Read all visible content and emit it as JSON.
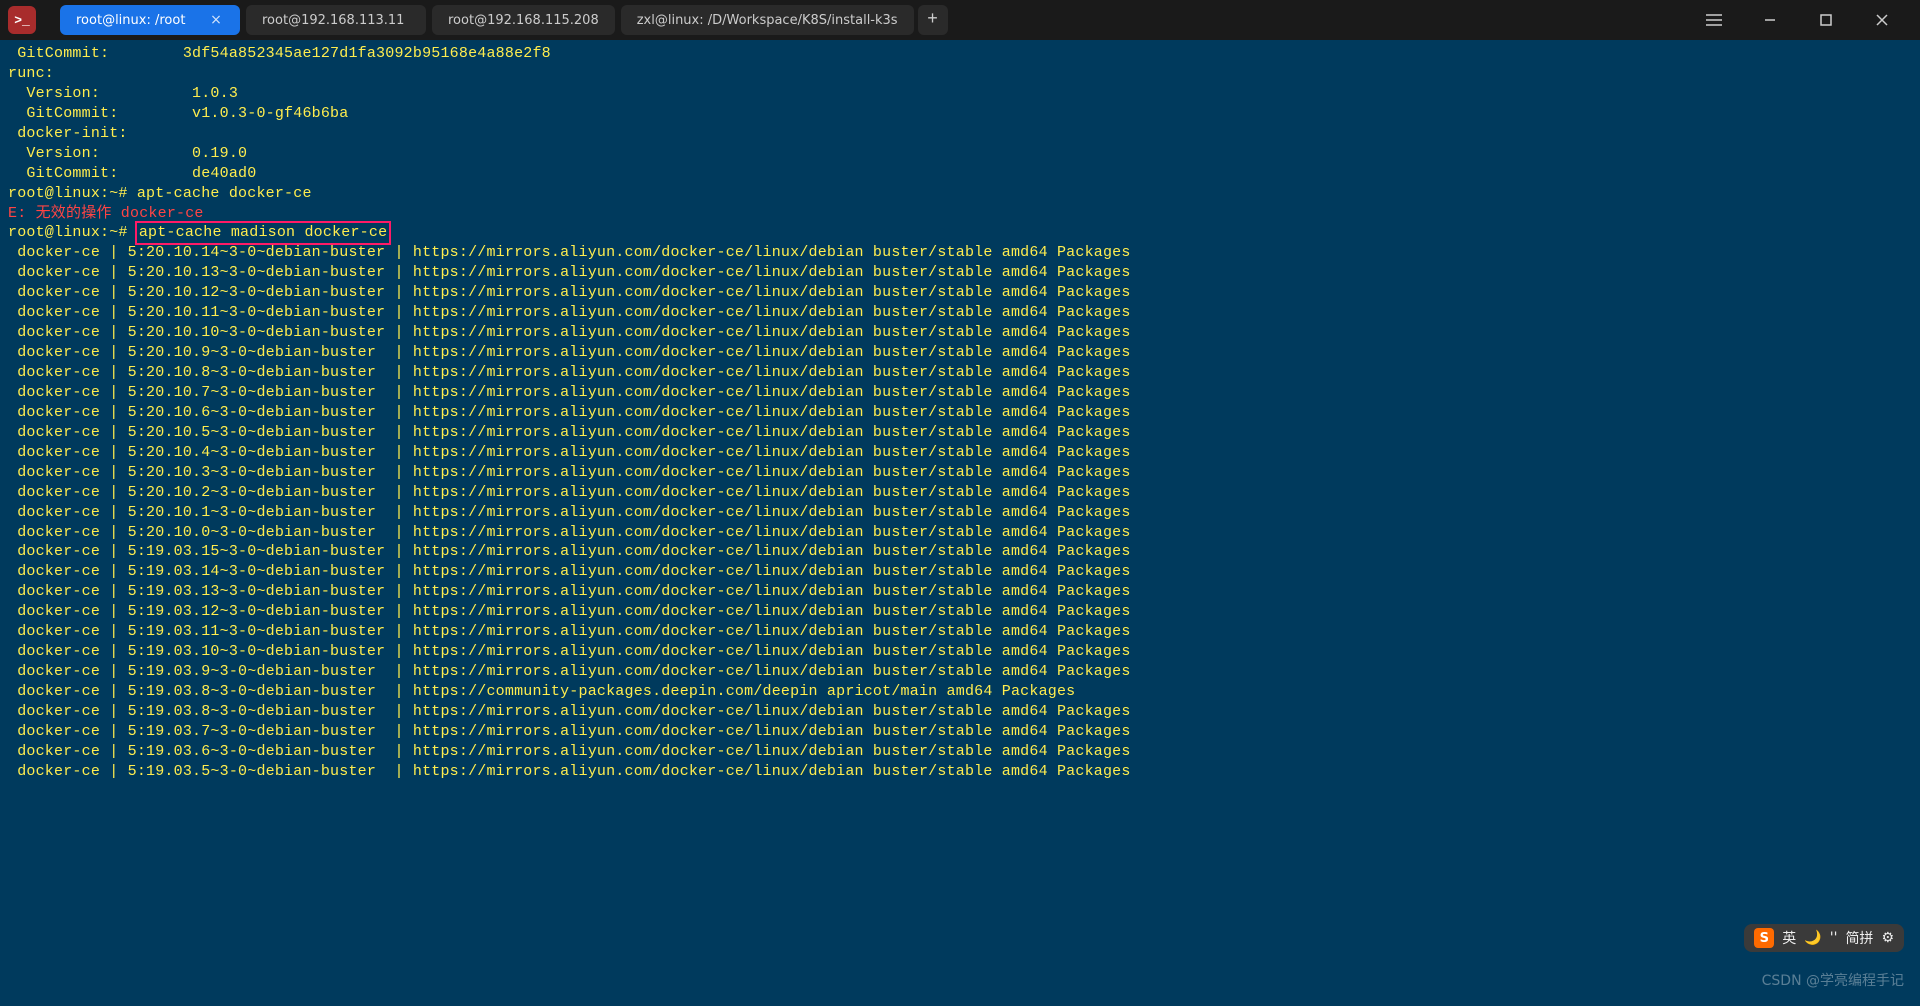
{
  "tabs": [
    {
      "label": "root@linux: /root",
      "active": true,
      "closable": true
    },
    {
      "label": "root@192.168.113.11",
      "active": false,
      "closable": false
    },
    {
      "label": "root@192.168.115.208",
      "active": false,
      "closable": false
    },
    {
      "label": "zxl@linux: /D/Workspace/K8S/install-k3s",
      "active": false,
      "closable": false
    }
  ],
  "header_output": {
    "git_commit_1": " GitCommit:        3df54a852345ae127d1fa3092b95168e4a88e2f8",
    "runc": "runc:",
    "version_1": "  Version:          1.0.3",
    "git_commit_2": "  GitCommit:        v1.0.3-0-gf46b6ba",
    "docker_init": " docker-init:",
    "version_2": "  Version:          0.19.0",
    "git_commit_3": "  GitCommit:        de40ad0"
  },
  "prompt1": {
    "host": "root@linux",
    "path": ":~#",
    "cmd": "apt-cache docker-ce"
  },
  "error_line": {
    "prefix": "E: 无效的操作 docker-ce"
  },
  "prompt2": {
    "host": "root@linux",
    "path": ":~#",
    "cmd": "apt-cache madison docker-ce"
  },
  "madison": [
    {
      "pkg": "docker-ce",
      "ver": "5:20.10.14~3-0~debian-buster",
      "src": "https://mirrors.aliyun.com/docker-ce/linux/debian buster/stable amd64 Packages"
    },
    {
      "pkg": "docker-ce",
      "ver": "5:20.10.13~3-0~debian-buster",
      "src": "https://mirrors.aliyun.com/docker-ce/linux/debian buster/stable amd64 Packages"
    },
    {
      "pkg": "docker-ce",
      "ver": "5:20.10.12~3-0~debian-buster",
      "src": "https://mirrors.aliyun.com/docker-ce/linux/debian buster/stable amd64 Packages"
    },
    {
      "pkg": "docker-ce",
      "ver": "5:20.10.11~3-0~debian-buster",
      "src": "https://mirrors.aliyun.com/docker-ce/linux/debian buster/stable amd64 Packages"
    },
    {
      "pkg": "docker-ce",
      "ver": "5:20.10.10~3-0~debian-buster",
      "src": "https://mirrors.aliyun.com/docker-ce/linux/debian buster/stable amd64 Packages"
    },
    {
      "pkg": "docker-ce",
      "ver": "5:20.10.9~3-0~debian-buster ",
      "src": "https://mirrors.aliyun.com/docker-ce/linux/debian buster/stable amd64 Packages"
    },
    {
      "pkg": "docker-ce",
      "ver": "5:20.10.8~3-0~debian-buster ",
      "src": "https://mirrors.aliyun.com/docker-ce/linux/debian buster/stable amd64 Packages"
    },
    {
      "pkg": "docker-ce",
      "ver": "5:20.10.7~3-0~debian-buster ",
      "src": "https://mirrors.aliyun.com/docker-ce/linux/debian buster/stable amd64 Packages"
    },
    {
      "pkg": "docker-ce",
      "ver": "5:20.10.6~3-0~debian-buster ",
      "src": "https://mirrors.aliyun.com/docker-ce/linux/debian buster/stable amd64 Packages"
    },
    {
      "pkg": "docker-ce",
      "ver": "5:20.10.5~3-0~debian-buster ",
      "src": "https://mirrors.aliyun.com/docker-ce/linux/debian buster/stable amd64 Packages"
    },
    {
      "pkg": "docker-ce",
      "ver": "5:20.10.4~3-0~debian-buster ",
      "src": "https://mirrors.aliyun.com/docker-ce/linux/debian buster/stable amd64 Packages"
    },
    {
      "pkg": "docker-ce",
      "ver": "5:20.10.3~3-0~debian-buster ",
      "src": "https://mirrors.aliyun.com/docker-ce/linux/debian buster/stable amd64 Packages"
    },
    {
      "pkg": "docker-ce",
      "ver": "5:20.10.2~3-0~debian-buster ",
      "src": "https://mirrors.aliyun.com/docker-ce/linux/debian buster/stable amd64 Packages"
    },
    {
      "pkg": "docker-ce",
      "ver": "5:20.10.1~3-0~debian-buster ",
      "src": "https://mirrors.aliyun.com/docker-ce/linux/debian buster/stable amd64 Packages"
    },
    {
      "pkg": "docker-ce",
      "ver": "5:20.10.0~3-0~debian-buster ",
      "src": "https://mirrors.aliyun.com/docker-ce/linux/debian buster/stable amd64 Packages"
    },
    {
      "pkg": "docker-ce",
      "ver": "5:19.03.15~3-0~debian-buster",
      "src": "https://mirrors.aliyun.com/docker-ce/linux/debian buster/stable amd64 Packages"
    },
    {
      "pkg": "docker-ce",
      "ver": "5:19.03.14~3-0~debian-buster",
      "src": "https://mirrors.aliyun.com/docker-ce/linux/debian buster/stable amd64 Packages"
    },
    {
      "pkg": "docker-ce",
      "ver": "5:19.03.13~3-0~debian-buster",
      "src": "https://mirrors.aliyun.com/docker-ce/linux/debian buster/stable amd64 Packages"
    },
    {
      "pkg": "docker-ce",
      "ver": "5:19.03.12~3-0~debian-buster",
      "src": "https://mirrors.aliyun.com/docker-ce/linux/debian buster/stable amd64 Packages"
    },
    {
      "pkg": "docker-ce",
      "ver": "5:19.03.11~3-0~debian-buster",
      "src": "https://mirrors.aliyun.com/docker-ce/linux/debian buster/stable amd64 Packages"
    },
    {
      "pkg": "docker-ce",
      "ver": "5:19.03.10~3-0~debian-buster",
      "src": "https://mirrors.aliyun.com/docker-ce/linux/debian buster/stable amd64 Packages"
    },
    {
      "pkg": "docker-ce",
      "ver": "5:19.03.9~3-0~debian-buster ",
      "src": "https://mirrors.aliyun.com/docker-ce/linux/debian buster/stable amd64 Packages"
    },
    {
      "pkg": "docker-ce",
      "ver": "5:19.03.8~3-0~debian-buster ",
      "src": "https://community-packages.deepin.com/deepin apricot/main amd64 Packages"
    },
    {
      "pkg": "docker-ce",
      "ver": "5:19.03.8~3-0~debian-buster ",
      "src": "https://mirrors.aliyun.com/docker-ce/linux/debian buster/stable amd64 Packages"
    },
    {
      "pkg": "docker-ce",
      "ver": "5:19.03.7~3-0~debian-buster ",
      "src": "https://mirrors.aliyun.com/docker-ce/linux/debian buster/stable amd64 Packages"
    },
    {
      "pkg": "docker-ce",
      "ver": "5:19.03.6~3-0~debian-buster ",
      "src": "https://mirrors.aliyun.com/docker-ce/linux/debian buster/stable amd64 Packages"
    },
    {
      "pkg": "docker-ce",
      "ver": "5:19.03.5~3-0~debian-buster ",
      "src": "https://mirrors.aliyun.com/docker-ce/linux/debian buster/stable amd64 Packages"
    }
  ],
  "ime": {
    "letter": "S",
    "lang": "英",
    "moon": "🌙",
    "sep": "''",
    "mode": "简拼",
    "gear": "⚙"
  },
  "watermark": "CSDN @学亮编程手记"
}
